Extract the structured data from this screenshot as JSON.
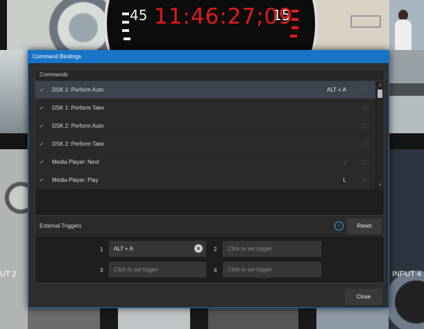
{
  "background": {
    "clock": {
      "time": "11:46:27;09",
      "left_number": "45",
      "right_number": "15"
    },
    "inputs": {
      "left": "UT 2",
      "right": "INPUT 4"
    }
  },
  "dialog": {
    "title": "Command Bindings",
    "commands": {
      "header": "Commands",
      "rows": [
        {
          "label": "DSK 1: Perform Auto",
          "binding": "ALT + A"
        },
        {
          "label": "DSK 1: Perform Take",
          "binding": ""
        },
        {
          "label": "DSK 2: Perform Auto",
          "binding": ""
        },
        {
          "label": "DSK 2: Perform Take",
          "binding": ""
        },
        {
          "label": "Media Player: Next",
          "binding": ";"
        },
        {
          "label": "Media Player: Play",
          "binding": "L"
        }
      ]
    },
    "external_triggers": {
      "title": "External Triggers",
      "reset_label": "Reset",
      "slots": [
        {
          "number": "1",
          "value": "ALT + A"
        },
        {
          "number": "2",
          "value": "Click to set trigger"
        },
        {
          "number": "3",
          "value": "Click to set trigger"
        },
        {
          "number": "4",
          "value": "Click to set trigger"
        }
      ]
    },
    "close_label": "Close"
  },
  "icons": {
    "check": "✓",
    "star": "☆",
    "info": "i",
    "clear": "×",
    "up": "▲",
    "down": "▼"
  },
  "colors": {
    "accent": "#1774c6",
    "clock_red": "#e11b1b",
    "selected_row": "#3d4450"
  }
}
